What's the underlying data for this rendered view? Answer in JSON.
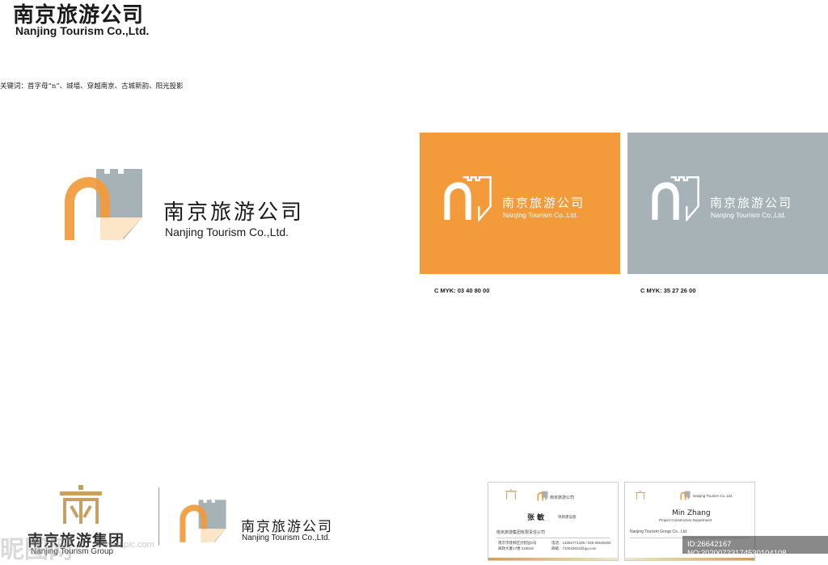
{
  "header": {
    "title_cn": "南京旅游公司",
    "title_en": "Nanjing Tourism Co.,Ltd.",
    "keywords": "关键词：首字母“n”、城墙、穿越南京、古城新韵、阳光投影"
  },
  "main_logo": {
    "name_cn": "南京旅游公司",
    "name_en": "Nanjing Tourism Co.,Ltd.",
    "colors": {
      "orange": "#f39a3b",
      "grey": "#a6b2b5"
    }
  },
  "panels": [
    {
      "name_cn": "南京旅游公司",
      "name_en": "Nanjing Tourism Co.,Ltd.",
      "bg": "#f39a3b",
      "cmyk": "C MYK:  03  40  80  00"
    },
    {
      "name_cn": "南京旅游公司",
      "name_en": "Nanjing Tourism Co.,Ltd.",
      "bg": "#a6b2b5",
      "cmyk": "C MYK:  35  27  26  00"
    }
  ],
  "group_logo": {
    "name_cn": "南京旅游集团",
    "name_en": "Nanjing Tourism Group",
    "color": "#c8a064"
  },
  "small_logo": {
    "name_cn": "南京旅游公司",
    "name_en": "Nanjing Tourism Co.,Ltd."
  },
  "cards": {
    "card1": {
      "brand_cn": "南京旅游公司",
      "name": "张  敏",
      "title": "项目建设部",
      "company": "南京旅游集团有限责任公司",
      "address1": "南京市建邺区创智园2号",
      "address2": "邮政大厦17楼   210019",
      "phone": "电话：13362771436 / 025 84536450",
      "email": "邮箱：710033022@qq.com"
    },
    "card2": {
      "brand_en": "Nanjing Tourism Co.,Ltd.",
      "name": "Min Zhang",
      "title": "Project Construction Department",
      "company": "Nanjing Tourism Group Co., Ltd."
    }
  },
  "watermark": {
    "site": "昵图网",
    "url": "www.nipic.com",
    "image_id": "ID:26642167 NO:20200723174530104108"
  }
}
